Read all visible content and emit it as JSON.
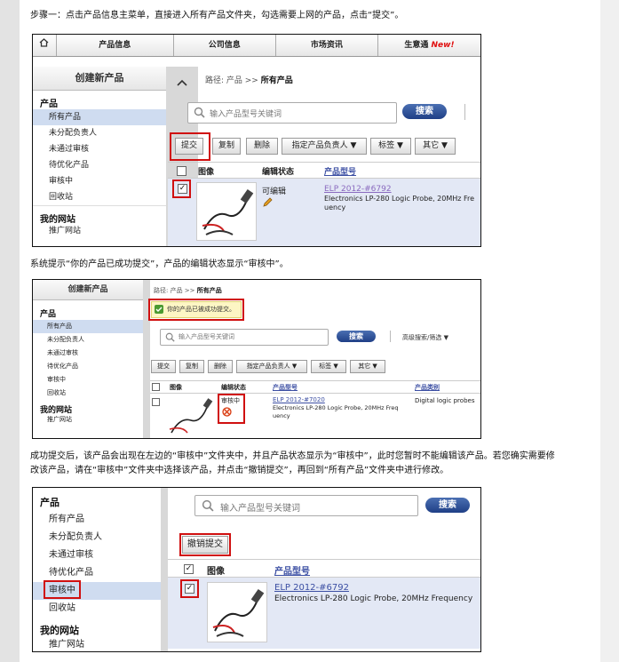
{
  "captions": {
    "step1": "步骤一：点击产品信息主菜单，直接进入所有产品文件夹，勾选需要上网的产品，点击“提交”。",
    "step2": "系统提示“你的产品已成功提交”，产品的编辑状态显示“审核中”。",
    "step3_line1": "成功提交后，该产品会出现在左边的“审核中”文件夹中，并且产品状态显示为“审核中”，此时您暂时不能编辑该产品。若您确实需要修",
    "step3_line2": "改该产品，请在“审核中”文件夹中选择该产品，并点击“撤销提交”，再回到“所有产品”文件夹中进行修改。"
  },
  "shot1": {
    "nav": [
      "产品信息",
      "公司信息",
      "市场资讯",
      "生意通"
    ],
    "nav_badge": "New!",
    "create_product": "创建新产品",
    "breadcrumb_prefix": "路径: 产品 >>",
    "breadcrumb_current": "所有产品",
    "search_placeholder": "输入产品型号关键词",
    "search_button": "搜索",
    "buttons": [
      "提交",
      "复制",
      "删除",
      "指定产品负责人 ▼",
      "标签 ▼",
      "其它 ▼"
    ],
    "sidebar_section1": "产品",
    "sidebar_items": [
      "所有产品",
      "未分配负责人",
      "未通过审核",
      "待优化产品",
      "审核中",
      "回收站"
    ],
    "sidebar_section2": "我的网站",
    "sidebar_items2": [
      "推广网站"
    ],
    "table_headers": [
      "图像",
      "编辑状态",
      "产品型号"
    ],
    "row": {
      "status": "可编辑",
      "model": "ELP 2012-#6792",
      "desc1": "Electronics LP-280 Logic Probe, 20MHz Fre",
      "desc2": "uency"
    }
  },
  "shot2": {
    "create_product": "创建新产品",
    "breadcrumb_prefix": "路径: 产品 >>",
    "breadcrumb_current": "所有产品",
    "success_msg": "你的产品已被成功提交。",
    "search_placeholder": "输入产品型号关键词",
    "search_button": "搜索",
    "advanced": "高级搜索/筛选 ▼",
    "buttons": [
      "提交",
      "复制",
      "删除",
      "指定产品负责人 ▼",
      "标签 ▼",
      "其它 ▼"
    ],
    "sidebar_section1": "产品",
    "sidebar_items": [
      "所有产品",
      "未分配负责人",
      "未通过审核",
      "待优化产品",
      "审核中",
      "回收站"
    ],
    "sidebar_section2": "我的网站",
    "sidebar_items2": [
      "推广网站"
    ],
    "table_headers": [
      "图像",
      "编辑状态",
      "产品型号",
      "产品类别"
    ],
    "row": {
      "status": "审核中",
      "model": "ELP 2012-#7020",
      "desc1": "Electronics LP-280 Logic Probe, 20MHz Freq",
      "desc2": "uency",
      "category": "Digital logic probes"
    }
  },
  "shot3": {
    "sidebar_section1": "产品",
    "sidebar_items": [
      "所有产品",
      "未分配负责人",
      "未通过审核",
      "待优化产品",
      "审核中",
      "回收站"
    ],
    "sidebar_section2": "我的网站",
    "sidebar_items2": [
      "推广网站"
    ],
    "search_placeholder": "输入产品型号关键词",
    "search_button": "搜索",
    "revoke_button": "撤销提交",
    "table_headers": [
      "图像",
      "产品型号"
    ],
    "row": {
      "model": "ELP 2012-#6792",
      "desc1": "Electronics LP-280 Logic Probe, 20MHz Frequency"
    }
  },
  "colors": {
    "highlight": "#d01010",
    "link": "#3c4fa3",
    "search_button": "#2a4a92",
    "selected_row": "#e3e8f5",
    "new_badge": "#e01010"
  },
  "icons": [
    "home-icon",
    "magnifier-icon",
    "pencil-icon",
    "forbidden-icon",
    "check-icon",
    "collapse-arrow-icon"
  ]
}
